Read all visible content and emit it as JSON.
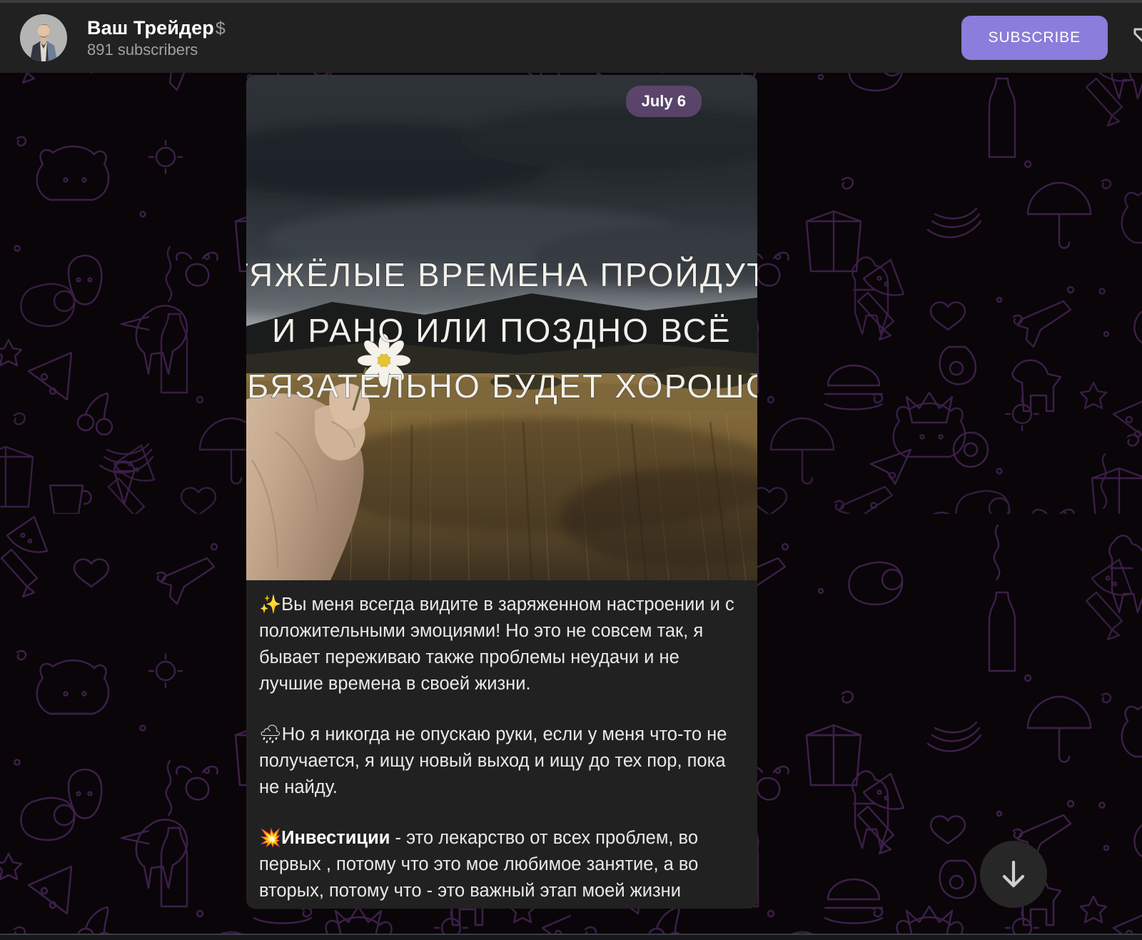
{
  "app": {
    "platform": "telegram-desktop",
    "theme": "dark",
    "colors": {
      "header_bg": "#212121",
      "bubble_bg": "#212121",
      "accent": "#8b7ddb",
      "chat_bg": "#0a0508",
      "doodle_stroke": "#3c1f4a",
      "text_primary": "#e9e9e9",
      "text_secondary": "#a0a0a0",
      "date_badge_bg": "#684a7a"
    }
  },
  "header": {
    "channel_title": "Ваш Трейдер",
    "title_emoji": "$",
    "subscriber_count": "891 subscribers",
    "avatar_alt": "channel-avatar",
    "subscribe_label": "SUBSCRIBE",
    "menu_icon": "more-options-icon"
  },
  "post": {
    "date_badge": "July 6",
    "image": {
      "alt": "hand-holding-daisy-in-wheat-field",
      "overlay_lines": [
        "ТЯЖЁЛЫЕ ВРЕМЕНА ПРОЙДУТ,",
        "И РАНО ИЛИ ПОЗДНО ВСЁ",
        "ОБЯЗАТЕЛЬНО БУДЕТ ХОРОШО."
      ]
    },
    "paragraphs": [
      {
        "emoji": "✨",
        "emoji_name": "sparkles-emoji",
        "text": "Вы меня всегда видите в заряженном настроении и с положительными эмоциями! Но это не совсем так, я бывает переживаю также проблемы неудачи и не лучшие времена в своей жизни."
      },
      {
        "emoji": "🌧",
        "emoji_name": "rain-cloud-emoji",
        "text": "Но я никогда не опускаю руки, если у меня что-то не получается, я ищу новый выход и ищу до тех пор, пока не найду."
      },
      {
        "emoji": "💥",
        "emoji_name": "collision-emoji",
        "bold_lead": "Инвестиции",
        "text": " - это лекарство от всех проблем, во первых , потому что это мое любимое занятие, а во вторых, потому что - это важный этап моей жизни"
      }
    ]
  },
  "controls": {
    "scroll_down_icon": "arrow-down-icon"
  }
}
